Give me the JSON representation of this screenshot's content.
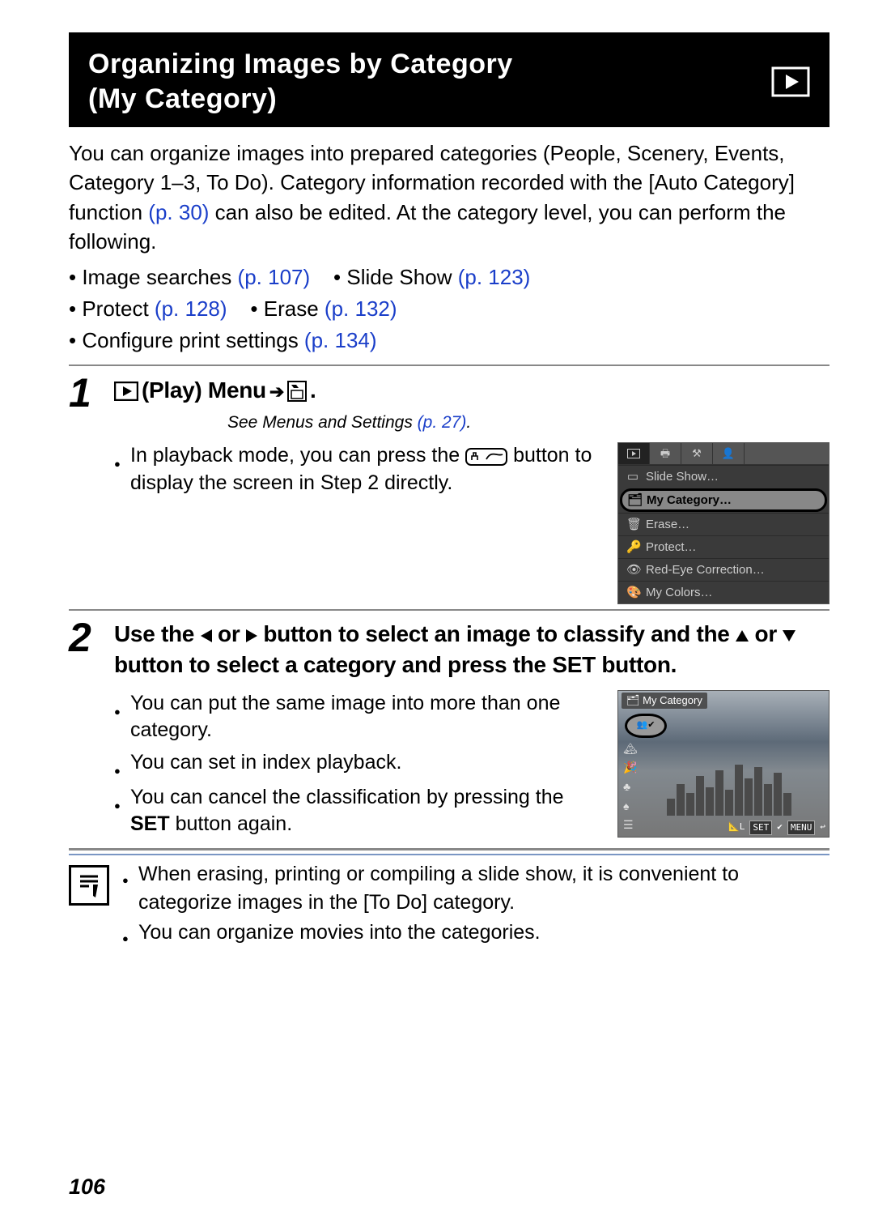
{
  "header": {
    "title_line1": "Organizing Images by Category",
    "title_line2": "(My Category)"
  },
  "intro": {
    "before_link": "You can organize images into prepared categories (People, Scenery, Events, Category 1–3, To Do). Category information recorded with the [Auto Category] function ",
    "link1": "(p. 30)",
    "after_link": " can also be edited. At the category level, you can perform the following."
  },
  "intro_bullets": {
    "row1a_label": "Image searches ",
    "row1a_link": "(p. 107)",
    "row1b_label": "Slide Show ",
    "row1b_link": "(p. 123)",
    "row2a_label": "Protect ",
    "row2a_link": "(p. 128)",
    "row2b_label": "Erase ",
    "row2b_link": "(p. 132)",
    "row3_label": "Configure print settings ",
    "row3_link": "(p. 134)"
  },
  "step1": {
    "num": "1",
    "heading_text": " (Play) Menu ",
    "heading_trail": ".",
    "see_text": "See Menus and Settings ",
    "see_link": "(p. 27)",
    "see_trail": ".",
    "bullet_a": "In playback mode, you can press the ",
    "bullet_b": " button to display the screen in Step 2 directly."
  },
  "menu_shot": {
    "items": {
      "slide": "Slide Show…",
      "mycat": "My Category…",
      "erase": "Erase…",
      "protect": "Protect…",
      "redeye": "Red-Eye Correction…",
      "mycolors": "My Colors…"
    }
  },
  "step2": {
    "num": "2",
    "heading_a": "Use the ",
    "heading_b": " or ",
    "heading_c": " button to select an image to classify and the ",
    "heading_d": " or ",
    "heading_e": " button to select a category and press the ",
    "heading_set": "SET",
    "heading_f": " button.",
    "bullets": {
      "b1": "You can put the same image into more than one category.",
      "b2": "You can set in index playback.",
      "b3a": "You can cancel the classification by pressing the ",
      "b3_set": "SET",
      "b3b": " button again."
    }
  },
  "cat_shot": {
    "title": "My Category",
    "bottom_set": "SET",
    "bottom_menu": "MENU"
  },
  "note": {
    "n1": "When erasing, printing or compiling a slide show, it is convenient to categorize images in the [To Do] category.",
    "n2": "You can organize movies into the categories."
  },
  "page_number": "106"
}
